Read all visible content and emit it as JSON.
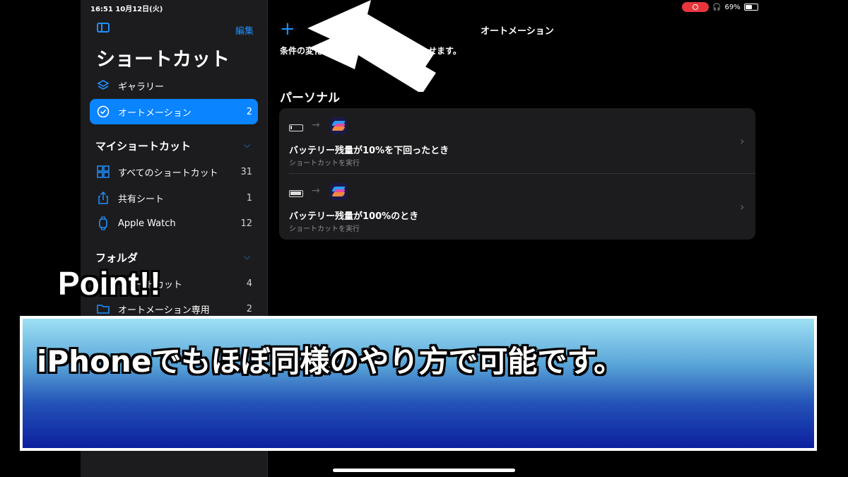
{
  "status": {
    "time": "16:51 10月12日(火)",
    "battery": "69%",
    "battery_level": 0.69
  },
  "sidebar": {
    "edit_label": "編集",
    "title": "ショートカット",
    "top_items": [
      {
        "label": "ギャラリー",
        "icon": "layers-icon"
      },
      {
        "label": "オートメーション",
        "count": "2",
        "icon": "clock-check-icon",
        "active": true
      }
    ],
    "my_shortcuts": {
      "heading": "マイショートカット",
      "items": [
        {
          "label": "すべてのショートカット",
          "count": "31",
          "icon": "grid-icon"
        },
        {
          "label": "共有シート",
          "count": "1",
          "icon": "share-icon"
        },
        {
          "label": "Apple Watch",
          "count": "12",
          "icon": "watch-icon"
        }
      ]
    },
    "folders": {
      "heading": "フォルダ",
      "items": [
        {
          "label": "ショートカット",
          "count": "4",
          "icon": "folder-icon"
        },
        {
          "label": "オートメーション専用",
          "count": "2",
          "icon": "folder-icon"
        }
      ]
    }
  },
  "main": {
    "nav_title": "オートメーション",
    "subtitle": "条件の変化",
    "subtitle_tail": "せます。",
    "section_heading": "パーソナル",
    "automations": [
      {
        "title": "バッテリー残量が10%を下回ったとき",
        "subtitle": "ショートカットを実行",
        "battery_fill": 0.1
      },
      {
        "title": "バッテリー残量が100%のとき",
        "subtitle": "ショートカットを実行",
        "battery_fill": 1.0
      }
    ]
  },
  "overlay": {
    "point_text": "Point!!",
    "caption": "iPhoneでもほぼ同様のやり方で可能です。"
  }
}
